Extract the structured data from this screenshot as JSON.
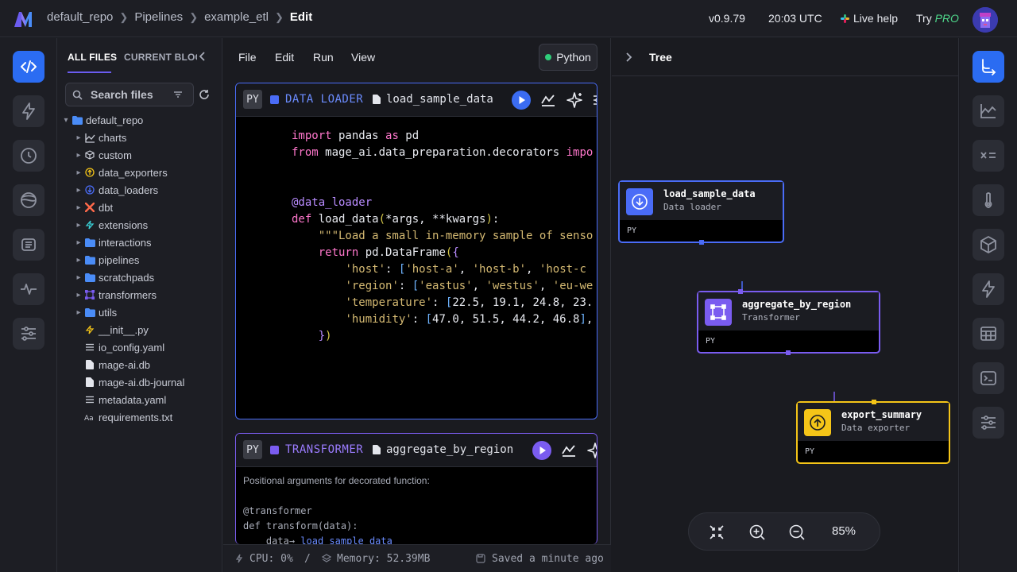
{
  "header": {
    "breadcrumbs": [
      "default_repo",
      "Pipelines",
      "example_etl",
      "Edit"
    ],
    "version": "v0.9.79",
    "time": "20:03 UTC",
    "live_help": "Live help",
    "try_label": "Try",
    "pro_label": "PRO"
  },
  "files_panel": {
    "tabs": [
      "ALL FILES",
      "CURRENT BLOCK"
    ],
    "search_placeholder": "Search files",
    "root": "default_repo",
    "items": [
      {
        "name": "charts",
        "type": "folder",
        "icon": "chart-icon"
      },
      {
        "name": "custom",
        "type": "folder",
        "icon": "cube-icon"
      },
      {
        "name": "data_exporters",
        "type": "folder",
        "icon": "exporter-icon"
      },
      {
        "name": "data_loaders",
        "type": "folder",
        "icon": "loader-icon"
      },
      {
        "name": "dbt",
        "type": "folder",
        "icon": "dbt-icon"
      },
      {
        "name": "extensions",
        "type": "folder",
        "icon": "lightning-icon"
      },
      {
        "name": "interactions",
        "type": "folder",
        "icon": "folder-icon"
      },
      {
        "name": "pipelines",
        "type": "folder",
        "icon": "folder-icon"
      },
      {
        "name": "scratchpads",
        "type": "folder",
        "icon": "folder-icon"
      },
      {
        "name": "transformers",
        "type": "folder",
        "icon": "transformer-icon"
      },
      {
        "name": "utils",
        "type": "folder",
        "icon": "folder-icon"
      },
      {
        "name": "__init__.py",
        "type": "file",
        "icon": "python-icon"
      },
      {
        "name": "io_config.yaml",
        "type": "file",
        "icon": "list-icon"
      },
      {
        "name": "mage-ai.db",
        "type": "file",
        "icon": "file-icon"
      },
      {
        "name": "mage-ai.db-journal",
        "type": "file",
        "icon": "file-icon"
      },
      {
        "name": "metadata.yaml",
        "type": "file",
        "icon": "list-icon"
      },
      {
        "name": "requirements.txt",
        "type": "file",
        "icon": "text-icon"
      }
    ]
  },
  "editor": {
    "menu": [
      "File",
      "Edit",
      "Run",
      "View"
    ],
    "language": "Python",
    "blocks": [
      {
        "badge": "PY",
        "type_label": "DATA LOADER",
        "name": "load_sample_data",
        "color": "#4a6cf7",
        "code": {
          "l1": [
            "import",
            " pandas ",
            "as",
            " pd"
          ],
          "l2": [
            "from",
            " mage_ai.data_preparation.decorators ",
            "impo"
          ],
          "l3": "@data_loader",
          "l4": [
            "def",
            " load_data",
            "(",
            "*args, **kwargs",
            ")",
            ":"
          ],
          "l5": "\"\"\"Load a small in-memory sample of senso",
          "l6": [
            "return",
            " pd.DataFrame",
            "(",
            "{"
          ],
          "l7": [
            "'host'",
            ": ",
            "[",
            "'host-a'",
            ", ",
            "'host-b'",
            ", ",
            "'host-c"
          ],
          "l8": [
            "'region'",
            ": ",
            "[",
            "'eastus'",
            ", ",
            "'westus'",
            ", ",
            "'eu-we"
          ],
          "l9": [
            "'temperature'",
            ": ",
            "[",
            "22.5, 19.1, 24.8, 23."
          ],
          "l10": [
            "'humidity'",
            ": ",
            "[",
            "47.0, 51.5, 44.2, 46.8",
            "]",
            ","
          ],
          "l11": [
            "}",
            ")"
          ]
        }
      },
      {
        "badge": "PY",
        "type_label": "TRANSFORMER",
        "name": "aggregate_by_region",
        "color": "#7a5cf0",
        "hint": "Positional arguments for decorated function:",
        "code_l1": "@transformer",
        "code_l2": "def transform(data):",
        "arg": "data",
        "arg_link": "load_sample_data"
      }
    ],
    "status": {
      "cpu": "CPU: 0%",
      "divider": "/",
      "memory": "Memory: 52.39MB",
      "saved": "Saved a minute ago"
    }
  },
  "tree_panel": {
    "title": "Tree",
    "nodes": [
      {
        "name": "load_sample_data",
        "type": "Data loader",
        "lang": "PY",
        "color": "#4a6cf7"
      },
      {
        "name": "aggregate_by_region",
        "type": "Transformer",
        "lang": "PY",
        "color": "#7a5cf0"
      },
      {
        "name": "export_summary",
        "type": "Data exporter",
        "lang": "PY",
        "color": "#f5c518"
      }
    ],
    "zoom": "85%"
  },
  "colors": {
    "accent": "#2b6cf2",
    "loader": "#4a6cf7",
    "transformer": "#7a5cf0",
    "exporter": "#f5c518",
    "python_dot": "#2fce7a"
  }
}
